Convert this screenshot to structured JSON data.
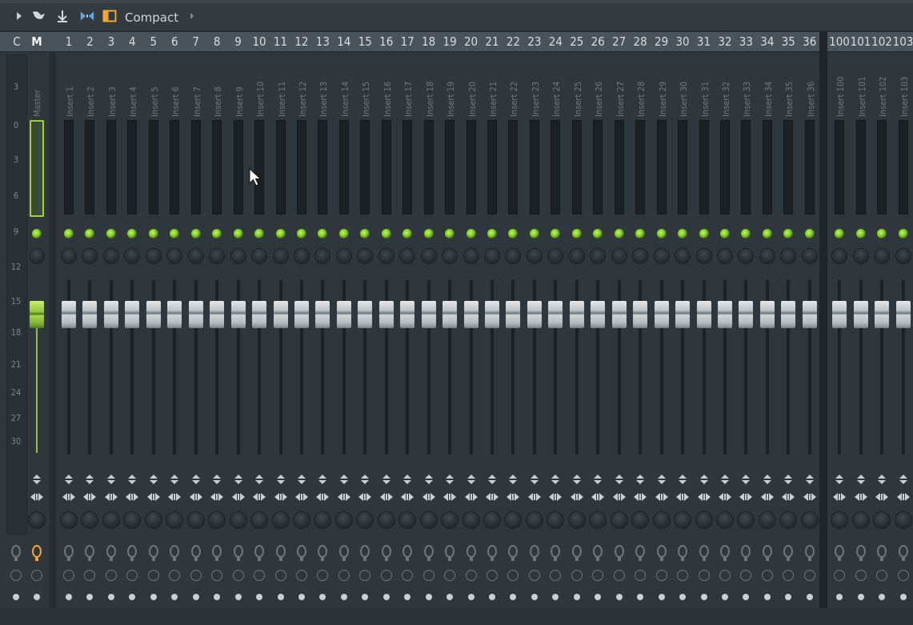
{
  "toolbar": {
    "view_mode_label": "Compact",
    "icons": [
      "play-arrow-icon",
      "link-icon",
      "anchor-icon",
      "bowtie-icon",
      "layout-square-icon",
      "more-arrow-icon"
    ]
  },
  "header": {
    "left_labels": [
      "C",
      "M"
    ],
    "insert_numbers_visible": [
      "1",
      "2",
      "3",
      "4",
      "5",
      "6",
      "7",
      "8",
      "9",
      "10",
      "11",
      "12",
      "13",
      "14",
      "15",
      "16",
      "17",
      "18",
      "19",
      "20",
      "21",
      "22",
      "23",
      "24",
      "25",
      "26",
      "27",
      "28",
      "29",
      "30",
      "31",
      "32",
      "33",
      "34",
      "35",
      "36"
    ],
    "extra_numbers_visible": [
      "100",
      "101",
      "102",
      "103"
    ]
  },
  "ruler_ticks": [
    "3",
    "0",
    "3",
    "6",
    "9",
    "12",
    "15",
    "18",
    "21",
    "24",
    "27",
    "30"
  ],
  "master": {
    "label": "Master"
  },
  "inserts": [
    "Insert 1",
    "Insert 2",
    "Insert 3",
    "Insert 4",
    "Insert 5",
    "Insert 6",
    "Insert 7",
    "Insert 8",
    "Insert 9",
    "Insert 10",
    "Insert 11",
    "Insert 12",
    "Insert 13",
    "Insert 14",
    "Insert 15",
    "Insert 16",
    "Insert 17",
    "Insert 18",
    "Insert 19",
    "Insert 20",
    "Insert 21",
    "Insert 22",
    "Insert 23",
    "Insert 24",
    "Insert 25",
    "Insert 26",
    "Insert 27",
    "Insert 28",
    "Insert 29",
    "Insert 30",
    "Insert 31",
    "Insert 32",
    "Insert 33",
    "Insert 34",
    "Insert 35",
    "Insert 36"
  ],
  "extra_inserts": [
    "Insert 100",
    "Insert 101",
    "Insert 102",
    "Insert 103"
  ],
  "colors": {
    "accent_green": "#9fd23f",
    "background": "#2f363c"
  }
}
